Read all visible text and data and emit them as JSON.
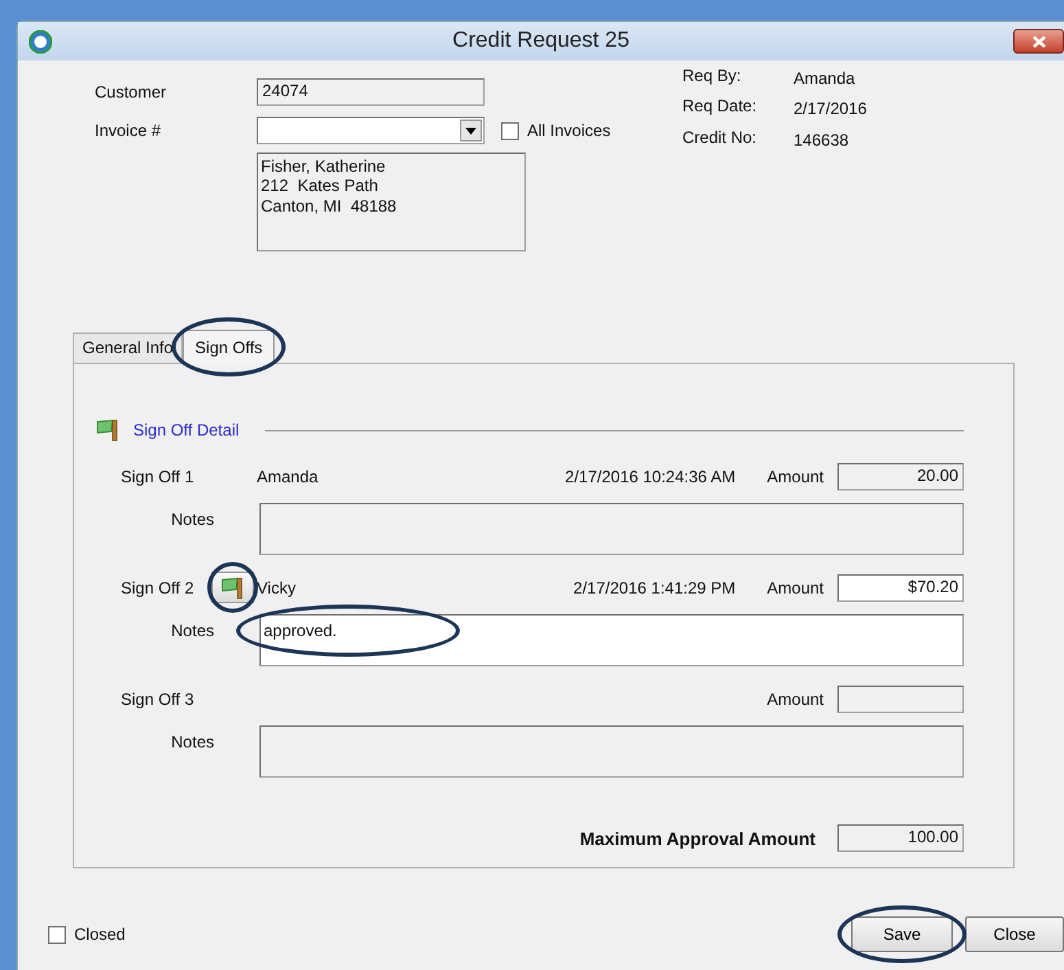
{
  "window": {
    "title": "Credit Request 25"
  },
  "header": {
    "customer": {
      "label": "Customer",
      "value": "24074"
    },
    "invoice": {
      "label": "Invoice #"
    },
    "all_invoices": {
      "label": "All Invoices",
      "checked": false
    },
    "address": [
      "Fisher, Katherine",
      "212  Kates Path",
      "Canton, MI  48188"
    ],
    "info": [
      {
        "label": "Req By:",
        "value": "Amanda"
      },
      {
        "label": "Req Date:",
        "value": "2/17/2016"
      },
      {
        "label": "Credit No:",
        "value": "146638"
      }
    ]
  },
  "tabs": [
    {
      "label": "General Info",
      "selected": false,
      "highlighted": false
    },
    {
      "label": "Sign Offs",
      "selected": true,
      "highlighted": true
    }
  ],
  "section_title": "Sign Off Detail",
  "signoffs": [
    {
      "label": "Sign Off 1",
      "name": "Amanda",
      "timestamp": "2/17/2016 10:24:36 AM",
      "amount_label": "Amount",
      "amount": "20.00",
      "notes_label": "Notes",
      "editable": false,
      "flag_button": false
    },
    {
      "label": "Sign Off 2",
      "name": "Vicky",
      "timestamp": "2/17/2016 1:41:29 PM",
      "amount_label": "Amount",
      "amount": "$70.20",
      "notes_label": "Notes",
      "notes": "approved.",
      "editable": true,
      "flag_button": true,
      "flag_highlighted": true,
      "notes_highlighted": true
    },
    {
      "label": "Sign Off 3",
      "amount_label": "Amount",
      "notes_label": "Notes",
      "editable": false,
      "flag_button": false
    }
  ],
  "max_approval": {
    "label": "Maximum Approval Amount",
    "value": "100.00"
  },
  "closed": {
    "label": "Closed",
    "checked": false
  },
  "buttons": [
    {
      "label": "Save",
      "highlighted": true
    },
    {
      "label": "Close",
      "highlighted": false
    }
  ]
}
